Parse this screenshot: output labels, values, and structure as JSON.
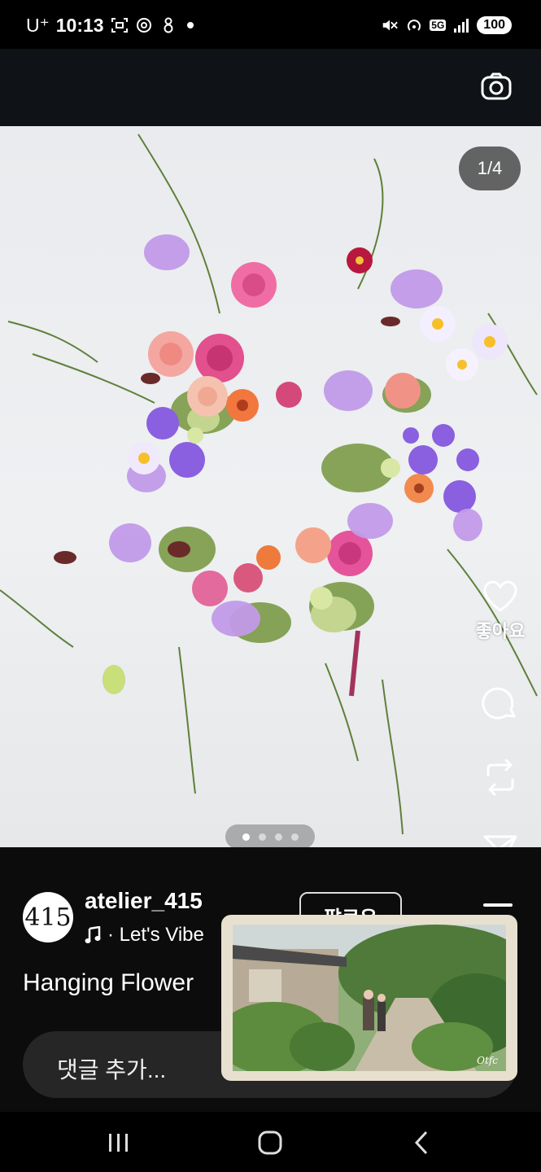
{
  "status_bar": {
    "carrier": "U⁺",
    "time": "10:13",
    "network": "5G",
    "battery": "100"
  },
  "top_bar": {
    "camera_icon": "camera-icon"
  },
  "media": {
    "counter": "1/4",
    "page_count": 4,
    "active_page": 1
  },
  "actions": {
    "like_label": "좋아요",
    "icons": [
      "heart-icon",
      "comment-icon",
      "repost-icon",
      "share-icon"
    ]
  },
  "post": {
    "avatar_text": "415",
    "username": "atelier_415",
    "music": "· Let's Vibe",
    "follow_label": "팔로우",
    "caption": "Hanging Flower"
  },
  "comment": {
    "placeholder": "댓글 추가..."
  },
  "colors": {
    "background": "#0c0c0c",
    "comment_box": "#262626",
    "counter_pill": "#3c3c3c"
  }
}
